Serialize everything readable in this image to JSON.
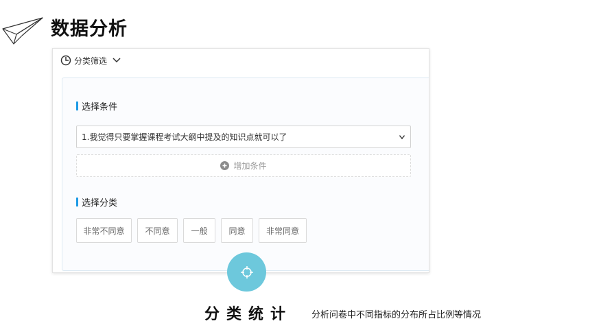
{
  "page": {
    "title": "数据分析"
  },
  "panel": {
    "header_label": "分类筛选",
    "condition_section_label": "选择条件",
    "selected_condition": "1.我觉得只要掌握课程考试大纲中提及的知识点就可以了",
    "add_condition_label": "增加条件",
    "category_section_label": "选择分类",
    "categories": [
      "非常不同意",
      "不同意",
      "一般",
      "同意",
      "非常同意"
    ]
  },
  "caption": {
    "title": "分类统计",
    "subtitle": "分析问卷中不同指标的分布所占比例等情况"
  },
  "icons": {
    "title_decoration": "paper-plane-icon",
    "header_icon": "pie-chart-icon",
    "dropdown": "chevron-down-icon",
    "add": "plus-circle-icon",
    "circle": "crosshair-icon"
  },
  "colors": {
    "accent": "#1f9be5",
    "circle": "#6dc8dc"
  }
}
